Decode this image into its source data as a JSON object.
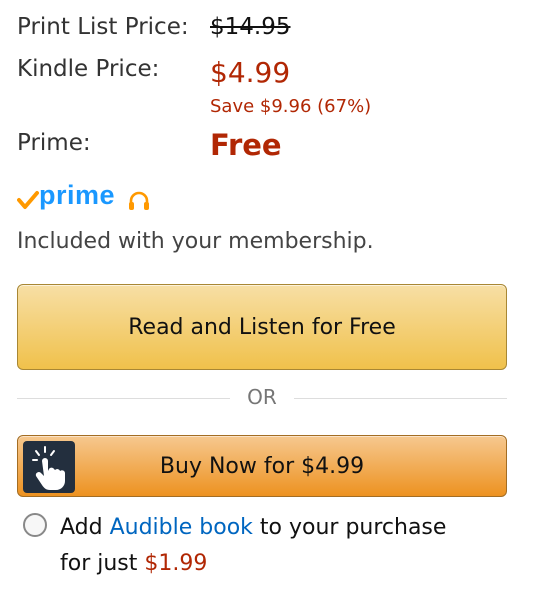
{
  "pricing": {
    "list_label": "Print List Price:",
    "list_price": "$14.95",
    "kindle_label": "Kindle Price:",
    "kindle_price": "$4.99",
    "savings": "Save $9.96 (67%)",
    "prime_label": "Prime:",
    "prime_price": "Free"
  },
  "prime_badge": {
    "text": "prime",
    "check_icon": "checkmark-icon",
    "audio_icon": "headphones-icon",
    "brand_color": "#1A98FF",
    "check_color": "#FF9900"
  },
  "membership_note": "Included with your membership.",
  "buttons": {
    "read_label": "Read and Listen for Free",
    "or_text": "OR",
    "buy_label": "Buy Now for $4.99",
    "buy_icon": "tap-hand-icon"
  },
  "addon": {
    "prefix": "Add ",
    "link": "Audible book",
    "middle": " to your purchase",
    "line2_prefix": "for just ",
    "price": "$1.99",
    "checked": false
  },
  "colors": {
    "price_red": "#B12704",
    "link_blue": "#0066C0",
    "button_yellow": "#F0C14B",
    "button_orange": "#ED9220"
  }
}
